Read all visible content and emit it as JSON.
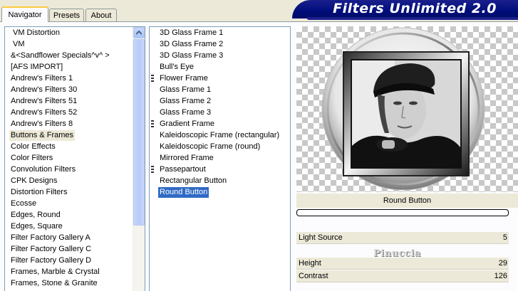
{
  "tabs": [
    {
      "label": "Navigator",
      "active": true
    },
    {
      "label": "Presets",
      "active": false
    },
    {
      "label": "About",
      "active": false
    }
  ],
  "header": {
    "title": "Filters Unlimited 2.0"
  },
  "categories": [
    "VM Distortion",
    "VM",
    "&<Sandflower Specials^v^ >",
    "[AFS IMPORT]",
    "Andrew's Filters 1",
    "Andrew's Filters 30",
    "Andrew's Filters 51",
    "Andrew's Filters 52",
    "Andrew's Filters 8",
    "Buttons & Frames",
    "Color Effects",
    "Color Filters",
    "Convolution Filters",
    "CPK Designs",
    "Distortion Filters",
    "Ecosse",
    "Edges, Round",
    "Edges, Square",
    "Filter Factory Gallery A",
    "Filter Factory Gallery C",
    "Filter Factory Gallery D",
    "Frames, Marble & Crystal",
    "Frames, Stone & Granite"
  ],
  "selected_category": "Buttons & Frames",
  "filters": [
    {
      "label": "3D Glass Frame 1",
      "marker": false
    },
    {
      "label": "3D Glass Frame 2",
      "marker": false
    },
    {
      "label": "3D Glass Frame 3",
      "marker": false
    },
    {
      "label": "Bull's Eye",
      "marker": false
    },
    {
      "label": "Flower Frame",
      "marker": true
    },
    {
      "label": "Glass Frame 1",
      "marker": false
    },
    {
      "label": "Glass Frame 2",
      "marker": false
    },
    {
      "label": "Glass Frame 3",
      "marker": false
    },
    {
      "label": "Gradient Frame",
      "marker": true
    },
    {
      "label": "Kaleidoscopic Frame (rectangular)",
      "marker": false
    },
    {
      "label": "Kaleidoscopic Frame (round)",
      "marker": false
    },
    {
      "label": "Mirrored Frame",
      "marker": false
    },
    {
      "label": "Passepartout",
      "marker": true
    },
    {
      "label": "Rectangular Button",
      "marker": false
    },
    {
      "label": "Round Button",
      "marker": false
    }
  ],
  "selected_filter": "Round Button",
  "preview": {
    "filter_name": "Round Button"
  },
  "params": [
    {
      "label": "Light Source",
      "value": "5"
    },
    {
      "label": "Height",
      "value": "29"
    },
    {
      "label": "Contrast",
      "value": "126"
    }
  ],
  "watermark": "Pinuccia",
  "colors": {
    "banner": "#000e7a",
    "selection": "#316ac5",
    "panel": "#ece9d8",
    "tab_highlight": "#ffc83c"
  }
}
